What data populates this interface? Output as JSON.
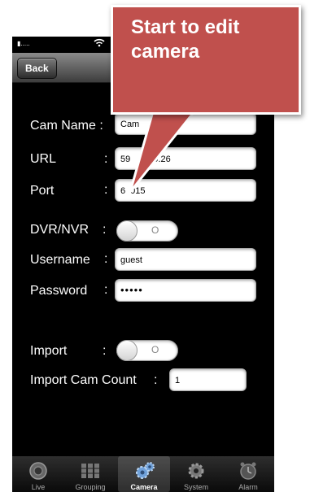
{
  "navbar": {
    "back_label": "Back"
  },
  "form": {
    "cam_name_label": "Cam Name :",
    "cam_name_value": "Cam",
    "url_label": "URL",
    "url_colon": ":",
    "url_value_prefix": "59",
    "url_value_suffix": "49.26",
    "port_label": "Port",
    "port_colon": ":",
    "port_value_start": "6",
    "port_value_end": "015",
    "dvr_label": "DVR/NVR",
    "dvr_colon": ":",
    "dvr_toggle": "O",
    "username_label": "Username",
    "username_colon": ":",
    "username_value": "guest",
    "password_label": "Password",
    "password_colon": ":",
    "password_value": "•••••",
    "import_label": "Import",
    "import_colon": ":",
    "import_toggle": "O",
    "import_count_label": "Import Cam Count",
    "import_count_colon": ":",
    "import_count_value": "1"
  },
  "tabs": [
    {
      "label": "Live",
      "icon": "camera-lens-icon"
    },
    {
      "label": "Grouping",
      "icon": "grid-icon"
    },
    {
      "label": "Camera",
      "icon": "gears-icon",
      "active": true
    },
    {
      "label": "System",
      "icon": "gear-icon"
    },
    {
      "label": "Alarm",
      "icon": "alarm-clock-icon"
    }
  ],
  "callout": {
    "text": "Start to edit camera",
    "color": "#c0504d"
  }
}
